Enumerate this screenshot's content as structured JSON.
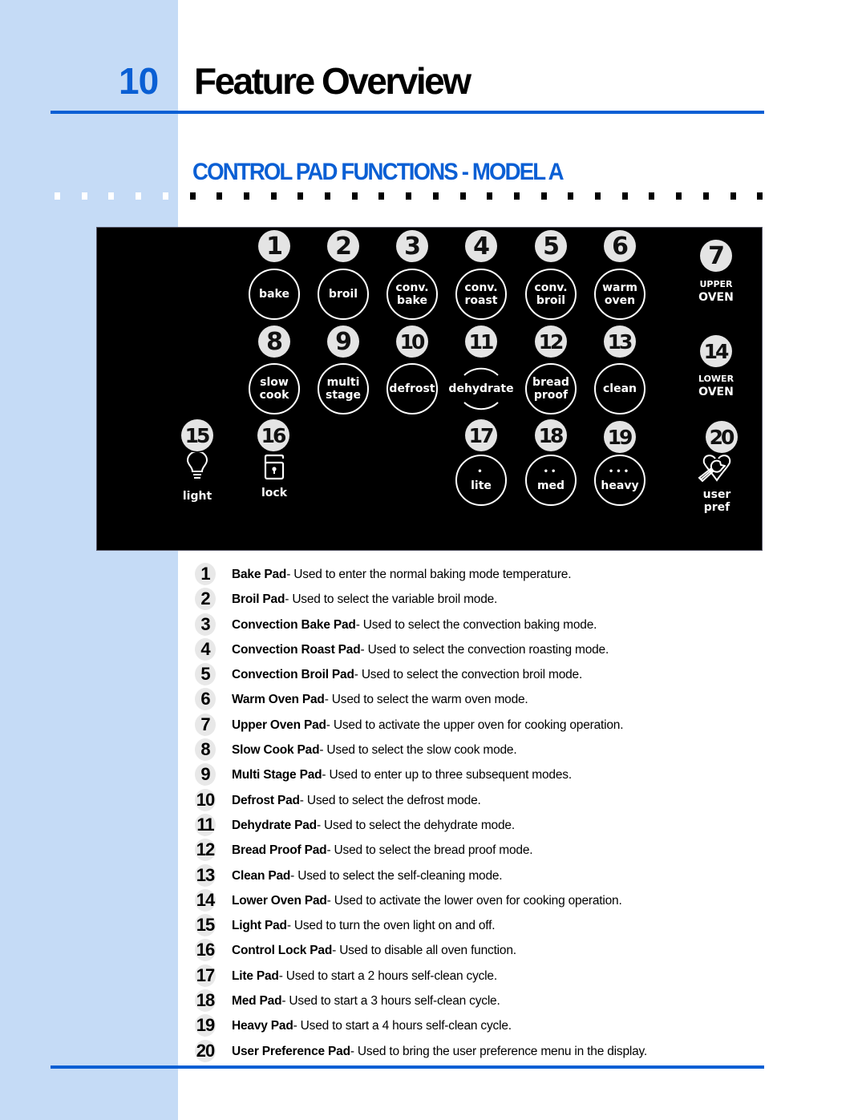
{
  "header": {
    "chapter_number": "10",
    "chapter_title": "Feature Overview",
    "section_title": "CONTROL PAD FUNCTIONS - MODEL A"
  },
  "colors": {
    "accent_blue": "#0a5fd4",
    "sidebar_blue": "#c5dbf6",
    "panel_black": "#000000",
    "badge_gray": "#e4e4e4"
  },
  "panel": {
    "pads": [
      {
        "num": "1",
        "lines": [
          "bake"
        ]
      },
      {
        "num": "2",
        "lines": [
          "broil"
        ]
      },
      {
        "num": "3",
        "lines": [
          "conv.",
          "bake"
        ]
      },
      {
        "num": "4",
        "lines": [
          "conv.",
          "roast"
        ]
      },
      {
        "num": "5",
        "lines": [
          "conv.",
          "broil"
        ]
      },
      {
        "num": "6",
        "lines": [
          "warm",
          "oven"
        ]
      },
      {
        "num": "7",
        "small": "UPPER",
        "big": "OVEN"
      },
      {
        "num": "8",
        "lines": [
          "slow",
          "cook"
        ]
      },
      {
        "num": "9",
        "lines": [
          "multi",
          "stage"
        ]
      },
      {
        "num": "10",
        "lines": [
          "defrost"
        ]
      },
      {
        "num": "11",
        "lines": [
          "dehydrate"
        ]
      },
      {
        "num": "12",
        "lines": [
          "bread",
          "proof"
        ]
      },
      {
        "num": "13",
        "lines": [
          "clean"
        ]
      },
      {
        "num": "14",
        "small": "LOWER",
        "big": "OVEN"
      },
      {
        "num": "15",
        "label": "light",
        "icon": "lightbulb-icon"
      },
      {
        "num": "16",
        "label": "lock",
        "icon": "lock-icon"
      },
      {
        "num": "17",
        "dots": "•",
        "lines": [
          "lite"
        ]
      },
      {
        "num": "18",
        "dots": "••",
        "lines": [
          "med"
        ]
      },
      {
        "num": "19",
        "dots": "•••",
        "lines": [
          "heavy"
        ]
      },
      {
        "num": "20",
        "label_lines": [
          "user",
          "pref"
        ],
        "icon": "wrench-heart-icon"
      }
    ]
  },
  "descriptions": [
    {
      "num": "1",
      "name": "Bake Pad",
      "text": "- Used to enter the normal baking mode temperature."
    },
    {
      "num": "2",
      "name": "Broil Pad",
      "text": "- Used to select the variable broil mode."
    },
    {
      "num": "3",
      "name": "Convection Bake Pad",
      "text": "- Used to select the convection baking mode."
    },
    {
      "num": "4",
      "name": "Convection Roast Pad",
      "text": "- Used to select the convection roasting mode."
    },
    {
      "num": "5",
      "name": "Convection Broil Pad",
      "text": "- Used to select the convection broil mode."
    },
    {
      "num": "6",
      "name": "Warm Oven Pad",
      "text": "- Used to select the warm oven mode."
    },
    {
      "num": "7",
      "name": "Upper Oven Pad",
      "text": "- Used to activate the upper oven for cooking operation."
    },
    {
      "num": "8",
      "name": "Slow Cook Pad",
      "text": "- Used to select the slow cook mode."
    },
    {
      "num": "9",
      "name": "Multi Stage Pad",
      "text": "- Used to enter up to three subsequent modes."
    },
    {
      "num": "10",
      "name": "Defrost Pad",
      "text": "- Used to select the defrost mode."
    },
    {
      "num": "11",
      "name": "Dehydrate Pad",
      "text": "- Used to select the dehydrate mode."
    },
    {
      "num": "12",
      "name": "Bread Proof Pad",
      "text": "- Used to select the bread proof mode."
    },
    {
      "num": "13",
      "name": "Clean Pad",
      "text": "- Used to select the self-cleaning mode."
    },
    {
      "num": "14",
      "name": "Lower Oven Pad",
      "text": "- Used to activate the lower oven for cooking operation."
    },
    {
      "num": "15",
      "name": "Light Pad",
      "text": "- Used to turn the oven light on and off."
    },
    {
      "num": "16",
      "name": "Control Lock Pad",
      "text": "- Used to disable all oven function."
    },
    {
      "num": "17",
      "name": "Lite Pad",
      "text": "- Used to start a 2 hours self-clean cycle."
    },
    {
      "num": "18",
      "name": "Med Pad",
      "text": "- Used to start a 3 hours self-clean cycle."
    },
    {
      "num": "19",
      "name": "Heavy Pad",
      "text": "- Used to start a 4 hours self-clean cycle."
    },
    {
      "num": "20",
      "name": "User Preference Pad",
      "text": "- Used to bring the user preference menu in the display."
    }
  ]
}
